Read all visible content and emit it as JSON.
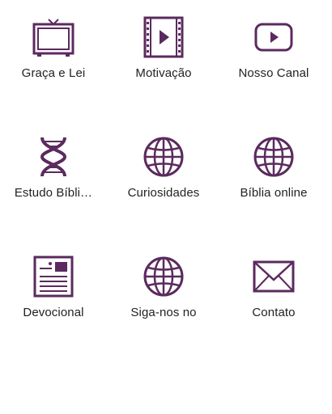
{
  "accent_color": "#5b2a5e",
  "menu": {
    "items": [
      {
        "label": "Graça e Lei",
        "icon": "tv-icon"
      },
      {
        "label": "Motivação",
        "icon": "video-film-icon"
      },
      {
        "label": "Nosso Canal",
        "icon": "youtube-play-icon"
      },
      {
        "label": "Estudo Bíbli…",
        "icon": "dna-icon"
      },
      {
        "label": "Curiosidades",
        "icon": "globe-icon"
      },
      {
        "label": "Bíblia online",
        "icon": "globe-icon"
      },
      {
        "label": "Devocional",
        "icon": "newspaper-icon"
      },
      {
        "label": "Siga-nos no",
        "icon": "globe-icon"
      },
      {
        "label": "Contato",
        "icon": "envelope-icon"
      }
    ]
  }
}
